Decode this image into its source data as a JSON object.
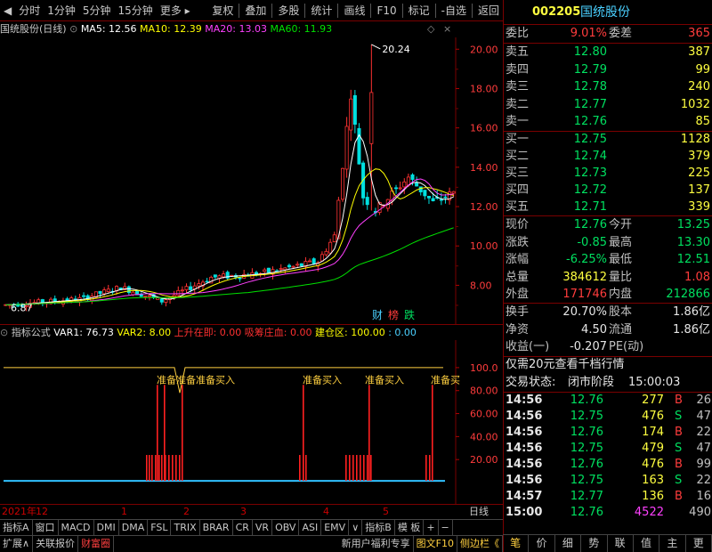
{
  "toolbar": {
    "left_items": [
      "分时",
      "1分钟",
      "5分钟",
      "15分钟",
      "更多 ▸"
    ],
    "right_items": [
      "复权",
      "叠加",
      "多股",
      "统计",
      "画线",
      "F10",
      "标记",
      "-自选",
      "返回"
    ]
  },
  "main_legend": {
    "stock": "国统股份",
    "period": "(日线)",
    "ma5": "MA5: 12.56",
    "ma10": "MA10: 12.39",
    "ma20": "MA20: 13.03",
    "ma60": "MA60: 11.93",
    "colors": {
      "ma5": "#ffffff",
      "ma10": "#ffff00",
      "ma20": "#ff40ff",
      "ma60": "#00e000"
    }
  },
  "main_chart": {
    "y_ticks": [
      "20.00",
      "18.00",
      "16.00",
      "14.00",
      "12.00",
      "10.00",
      "8.00"
    ],
    "high_label": "20.24",
    "low_label": "6.87",
    "badges": [
      "财",
      "榜",
      "跌"
    ]
  },
  "indicator_legend": {
    "name": "指标公式",
    "var1": "VAR1: 76.73",
    "var2": "VAR2: 8.00",
    "rising": "上升在即: 0.00",
    "absorb": "吸筹庄血: 0.00",
    "build": "建仓区: 100.00",
    "extra": ": 0.00"
  },
  "indicator_chart": {
    "y_ticks": [
      "100.0",
      "80.00",
      "60.00",
      "40.00",
      "20.00"
    ],
    "signal_label": "准备买入",
    "overlap_label": "准备准备准备买入",
    "cut_label": "准备买"
  },
  "date_axis": {
    "year": "2021年",
    "months": [
      "12",
      "1",
      "2",
      "3",
      "4",
      "5"
    ],
    "unit": "日线"
  },
  "tabs_row1": [
    "指标A",
    "窗口",
    "MACD",
    "DMI",
    "DMA",
    "FSL",
    "TRIX",
    "BRAR",
    "CR",
    "VR",
    "OBV",
    "ASI",
    "EMV",
    "∨",
    "指标B",
    "模 板",
    "+",
    "−"
  ],
  "tabs_row2": [
    "扩展∧",
    "关联报价",
    "财富圈"
  ],
  "tabs_row2_right": [
    "新用户福利专享",
    "图文F10",
    "侧边栏《"
  ],
  "quote": {
    "code": "002205",
    "name": "国统股份",
    "weibi_label": "委比",
    "weibi": "9.01%",
    "weicha_label": "委差",
    "weicha": "365",
    "asks": [
      {
        "label": "卖五",
        "price": "12.80",
        "vol": "387"
      },
      {
        "label": "卖四",
        "price": "12.79",
        "vol": "99"
      },
      {
        "label": "卖三",
        "price": "12.78",
        "vol": "240"
      },
      {
        "label": "卖二",
        "price": "12.77",
        "vol": "1032"
      },
      {
        "label": "卖一",
        "price": "12.76",
        "vol": "85"
      }
    ],
    "bids": [
      {
        "label": "买一",
        "price": "12.75",
        "vol": "1128"
      },
      {
        "label": "买二",
        "price": "12.74",
        "vol": "379"
      },
      {
        "label": "买三",
        "price": "12.73",
        "vote": "",
        "vol": "225"
      },
      {
        "label": "买四",
        "price": "12.72",
        "vol": "137"
      },
      {
        "label": "买五",
        "price": "12.71",
        "vol": "339"
      }
    ],
    "stats": [
      {
        "l1": "现价",
        "v1": "12.76",
        "l2": "今开",
        "v2": "13.25",
        "c1": "green",
        "c2": "green"
      },
      {
        "l1": "涨跌",
        "v1": "-0.85",
        "l2": "最高",
        "v2": "13.30",
        "c1": "green",
        "c2": "green"
      },
      {
        "l1": "涨幅",
        "v1": "-6.25%",
        "l2": "最低",
        "v2": "12.51",
        "c1": "green",
        "c2": "green"
      },
      {
        "l1": "总量",
        "v1": "384612",
        "l2": "量比",
        "v2": "1.08",
        "c1": "yellow",
        "c2": "red"
      },
      {
        "l1": "外盘",
        "v1": "171746",
        "l2": "内盘",
        "v2": "212866",
        "c1": "red",
        "c2": "green"
      }
    ],
    "stats2": [
      {
        "l1": "换手",
        "v1": "20.70%",
        "l2": "股本",
        "v2": "1.86亿"
      },
      {
        "l1": "净资",
        "v1": "4.50",
        "l2": "流通",
        "v2": "1.86亿"
      },
      {
        "l1": "收益(一)",
        "v1": "-0.207",
        "l2": "PE(动)",
        "v2": ""
      }
    ],
    "promo": "仅需20元查看千档行情",
    "status_label": "交易状态:",
    "status": "闭市阶段",
    "status_time": "15:00:03",
    "ticks": [
      {
        "t": "14:56",
        "p": "12.76",
        "v": "277",
        "s": "B",
        "n": "26",
        "vc": "yellow",
        "sc": "red"
      },
      {
        "t": "14:56",
        "p": "12.75",
        "v": "476",
        "s": "S",
        "n": "47",
        "vc": "yellow",
        "sc": "green"
      },
      {
        "t": "14:56",
        "p": "12.76",
        "v": "174",
        "s": "B",
        "n": "22",
        "vc": "yellow",
        "sc": "red"
      },
      {
        "t": "14:56",
        "p": "12.75",
        "v": "479",
        "s": "S",
        "n": "47",
        "vc": "yellow",
        "sc": "green"
      },
      {
        "t": "14:56",
        "p": "12.76",
        "v": "476",
        "s": "B",
        "n": "99",
        "vc": "yellow",
        "sc": "red"
      },
      {
        "t": "14:56",
        "p": "12.75",
        "v": "163",
        "s": "S",
        "n": "22",
        "vc": "yellow",
        "sc": "green"
      },
      {
        "t": "14:57",
        "p": "12.77",
        "v": "136",
        "s": "B",
        "n": "16",
        "vc": "yellow",
        "sc": "red"
      },
      {
        "t": "15:00",
        "p": "12.76",
        "v": "4522",
        "s": "",
        "n": "490",
        "vc": "mag",
        "sc": "gray"
      }
    ],
    "bottom_tabs": [
      "笔",
      "价",
      "细",
      "势",
      "联",
      "值",
      "主",
      "更"
    ]
  }
}
